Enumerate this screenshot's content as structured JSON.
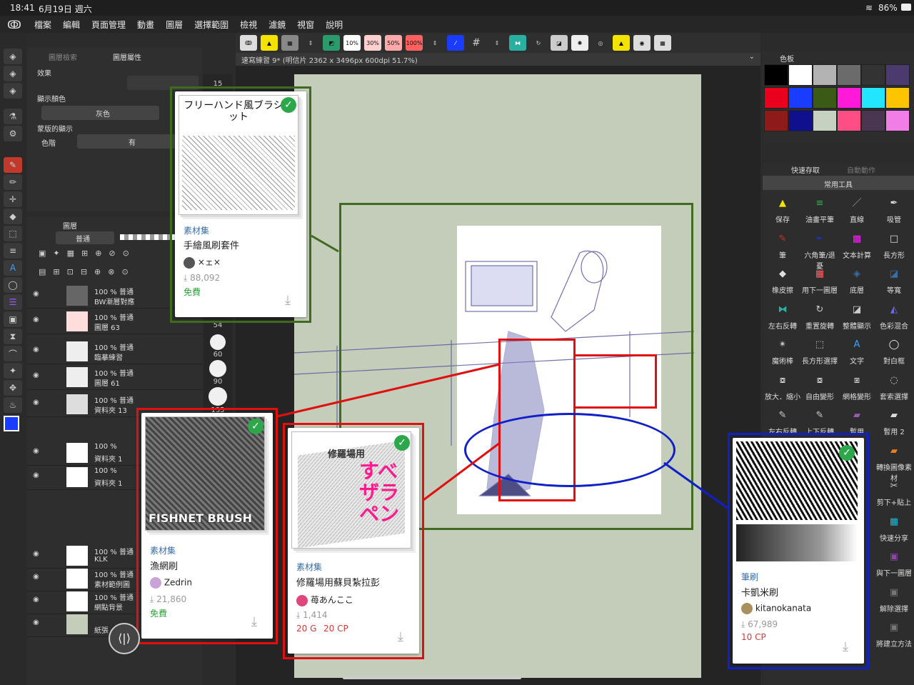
{
  "status": {
    "time": "18:41",
    "date": "6月19日 週六",
    "battery": "86%"
  },
  "menu": [
    "檔案",
    "編輯",
    "頁面管理",
    "動畫",
    "圖層",
    "選擇範圍",
    "檢視",
    "濾鏡",
    "視窗",
    "說明"
  ],
  "toolbar": {
    "p10": "10%",
    "p30": "30%",
    "p50": "50%",
    "p100": "100%"
  },
  "tab": {
    "title": "速寫練習 9* (明信片 2362 x 3496px 600dpi 51.7%)"
  },
  "prop": {
    "tab1": "圖層檢索",
    "tab2": "圖層屬性",
    "effect": "效果",
    "display_color": "顯示顏色",
    "display_color_value": "灰色",
    "mask_display": "蒙版的顯示",
    "color_level": "色階",
    "color_level_value": "有"
  },
  "layers": {
    "tab": "圖層",
    "blend": "普通",
    "rows": [
      {
        "pct": "100 % 普通",
        "name": "BW漸層對應"
      },
      {
        "pct": "100 % 普通",
        "name": "圖層 63"
      },
      {
        "pct": "100 % 普通",
        "name": "臨摹練習"
      },
      {
        "pct": "100 % 普通",
        "name": "圖層 61"
      },
      {
        "pct": "100 % 普通",
        "name": "資料夾 13"
      },
      {
        "pct": "100 %",
        "name": "資料夾 1"
      },
      {
        "pct": "100 %",
        "name": "資料夾 1"
      },
      {
        "pct": "100 % 普通",
        "name": "KLK"
      },
      {
        "pct": "100 % 普通",
        "name": "素材範例圖"
      },
      {
        "pct": "100 % 普通",
        "name": "網點背景"
      },
      {
        "pct": "",
        "name": "紙張"
      }
    ]
  },
  "brush_sizes": [
    "15",
    "54",
    "60",
    "90",
    "135"
  ],
  "palette": {
    "title": "色板",
    "colors": [
      "#000000",
      "#ffffff",
      "#b3b3b3",
      "#6b6b6b",
      "#333333",
      "#4a3a6e",
      "#e8001c",
      "#1a3cff",
      "#3b5a16",
      "#ff19d9",
      "#22e5ff",
      "#ffc400",
      "#8e1a1a",
      "#10108e",
      "#c7d1bf",
      "#ff4d86",
      "#4a3650",
      "#f07ee6"
    ]
  },
  "quick": {
    "tab1": "快速存取",
    "tab2": "自動動作",
    "set": "常用工具",
    "tools": [
      "保存",
      "油畫平筆",
      "直線",
      "吸管",
      "筆",
      "六角筆/退憂",
      "文本計算",
      "長方形",
      "橡皮擦",
      "用下一圖層",
      "底層",
      "等寬",
      "左右反轉",
      "重置旋轉",
      "整體顯示",
      "色彩混合",
      "魔術棒",
      "長方形選擇",
      "文字",
      "對白框",
      "放大．縮小",
      "自由變形",
      "網格變形",
      "套索選擇",
      "左右反轉",
      "上下反轉",
      "暫用",
      "暫用 2",
      "轉換圖像素材",
      "剪下+貼上",
      "快速分享",
      "與下一圖層",
      "解除選擇",
      "將建立方法"
    ]
  },
  "cards": {
    "c1": {
      "title_art": "フリーハンド風ブラシセット",
      "cat": "素材集",
      "name": "手繪風刷套件",
      "author": "×ェ×",
      "downloads": "88,092",
      "price": "免費"
    },
    "c2": {
      "title_art": "FISHNET BRUSH",
      "cat": "素材集",
      "name": "漁網刷",
      "author": "Zedrin",
      "downloads": "21,860",
      "price": "免費"
    },
    "c3": {
      "title_art": "修羅場用",
      "title_art2": "すべザラペン",
      "cat": "素材集",
      "name": "修羅場用蘇貝紮拉彭",
      "author": "苺あんここ",
      "downloads": "1,414",
      "price_g": "20 G",
      "price_cp": "20 CP"
    },
    "c4": {
      "cat": "筆刷",
      "name": "卡凱米刷",
      "author": "kitanokanata",
      "downloads": "67,989",
      "price": "10 CP"
    }
  },
  "colors": {
    "green_frame": "#3f6a1f",
    "red_frame": "#e01010",
    "blue_frame": "#1020c8",
    "canvas_bg": "#c3cdb9",
    "free": "#2aa336",
    "cp": "#d23a3a"
  }
}
